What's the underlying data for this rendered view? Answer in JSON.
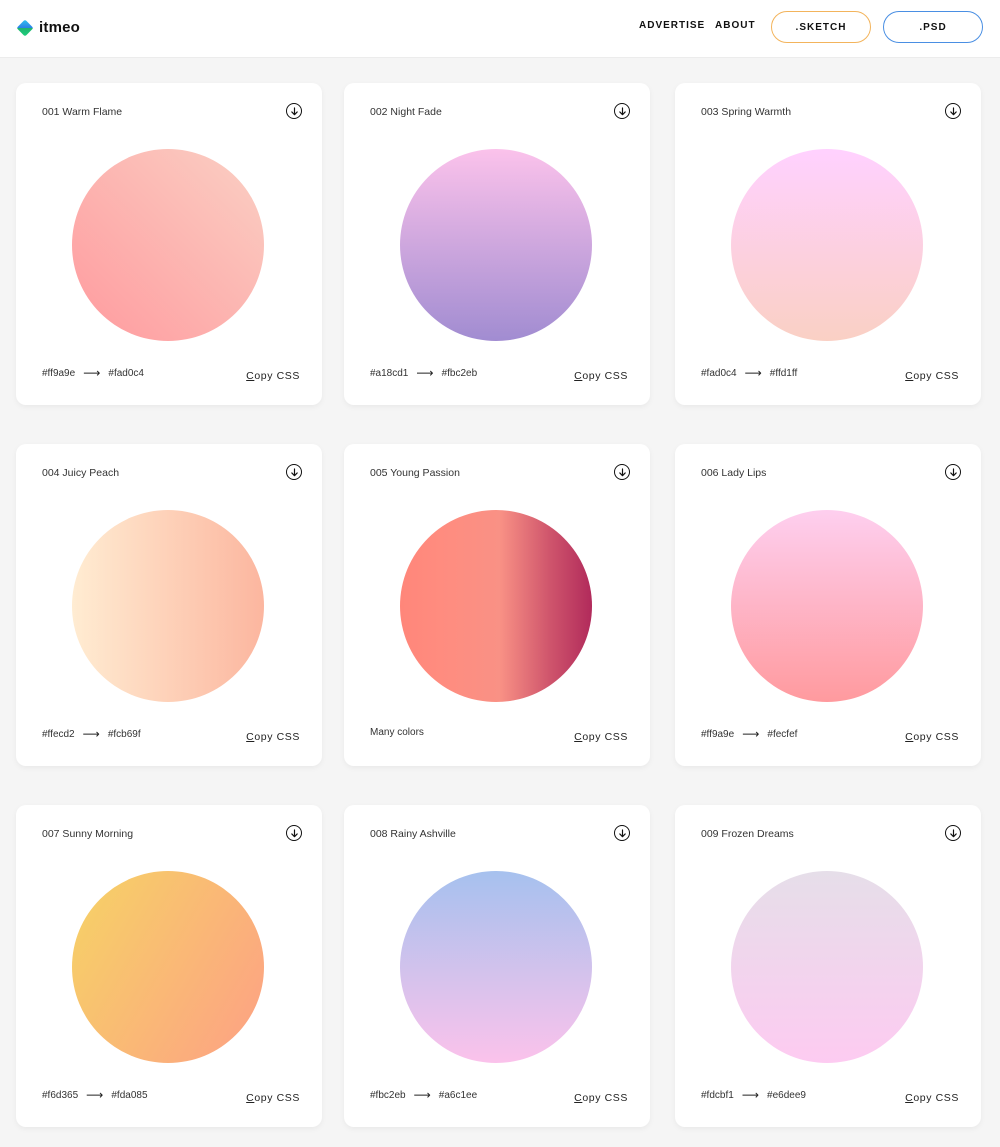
{
  "brand": {
    "name": "itmeo"
  },
  "nav": {
    "advertise": "ADVERTISE",
    "about": "ABOUT",
    "sketch": ".SKETCH",
    "psd": ".PSD"
  },
  "copy_label_first": "C",
  "copy_label_rest": "opy CSS",
  "cards": [
    {
      "title": "001 Warm Flame",
      "from": "#ff9a9e",
      "to": "#fad0c4",
      "arrow": "⟶",
      "colors": [
        "#ff9a9e",
        "#fad0c4"
      ],
      "direction": "to top right"
    },
    {
      "title": "002 Night Fade",
      "from": "#a18cd1",
      "to": "#fbc2eb",
      "arrow": "⟶",
      "colors": [
        "#a18cd1",
        "#fbc2eb"
      ],
      "direction": "to top"
    },
    {
      "title": "003 Spring Warmth",
      "from": "#fad0c4",
      "to": "#ffd1ff",
      "arrow": "⟶",
      "colors": [
        "#fad0c4",
        "#ffd1ff"
      ],
      "direction": "to top"
    },
    {
      "title": "004 Juicy Peach",
      "from": "#ffecd2",
      "to": "#fcb69f",
      "arrow": "⟶",
      "colors": [
        "#ffecd2",
        "#fcb69f"
      ],
      "direction": "to right"
    },
    {
      "title": "005 Young Passion",
      "many": "Many colors",
      "colors": [
        "#ff8177",
        "#ff867a",
        "#ff8c7f",
        "#f99185",
        "#cf556c",
        "#b12a5b"
      ],
      "direction": "to right",
      "stops": [
        0,
        0,
        21,
        52,
        78,
        100
      ]
    },
    {
      "title": "006 Lady Lips",
      "from": "#ff9a9e",
      "to": "#fecfef",
      "arrow": "⟶",
      "colors": [
        "#ff9a9e",
        "#fecfef"
      ],
      "direction": "to top"
    },
    {
      "title": "007 Sunny Morning",
      "from": "#f6d365",
      "to": "#fda085",
      "arrow": "⟶",
      "colors": [
        "#f6d365",
        "#fda085"
      ],
      "direction": "120deg"
    },
    {
      "title": "008 Rainy Ashville",
      "from": "#fbc2eb",
      "to": "#a6c1ee",
      "arrow": "⟶",
      "colors": [
        "#fbc2eb",
        "#a6c1ee"
      ],
      "direction": "to top"
    },
    {
      "title": "009 Frozen Dreams",
      "from": "#fdcbf1",
      "to": "#e6dee9",
      "arrow": "⟶",
      "colors": [
        "#fdcbf1",
        "#e6dee9"
      ],
      "direction": "to top"
    }
  ]
}
